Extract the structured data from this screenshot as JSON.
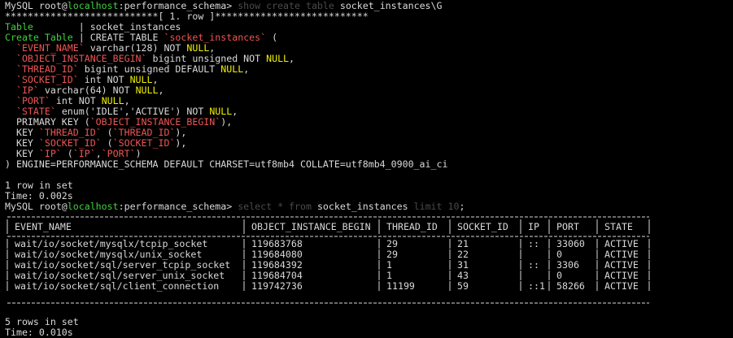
{
  "colors": {
    "background": "#000000",
    "text": "#d9d9d9",
    "green": "#3ed13e",
    "red": "#ee5555",
    "yellow": "#f0f000",
    "dim": "#4a4a4a",
    "cyan": "#00c8d6"
  },
  "prompt1": {
    "prefix": "MySQL root@",
    "host": "localhost",
    "db": ":performance_schema>",
    "kw1": " show create table ",
    "arg": "socket_instances\\G"
  },
  "row_banner": "***************************[ 1. row ]***************************",
  "result_ct": {
    "table_key": "Table",
    "table_pad": "        ",
    "table_sep": "| ",
    "table_val": "socket_instances",
    "ct_key": "Create Table",
    "ct_sep": " | ",
    "ct_val1": "CREATE TABLE ",
    "ct_name": "`socket_instances`",
    "ct_val2": " ("
  },
  "ddl": {
    "l1a": "  ",
    "l1b": "`EVENT_NAME`",
    "l1c": " varchar(128) NOT ",
    "l1d": "NULL",
    "l1e": ",",
    "l2a": "  ",
    "l2b": "`OBJECT_INSTANCE_BEGIN`",
    "l2c": " bigint unsigned NOT ",
    "l2d": "NULL",
    "l2e": ",",
    "l3a": "  ",
    "l3b": "`THREAD_ID`",
    "l3c": " bigint unsigned DEFAULT ",
    "l3d": "NULL",
    "l3e": ",",
    "l4a": "  ",
    "l4b": "`SOCKET_ID`",
    "l4c": " int NOT ",
    "l4d": "NULL",
    "l4e": ",",
    "l5a": "  ",
    "l5b": "`IP`",
    "l5c": " varchar(64) NOT ",
    "l5d": "NULL",
    "l5e": ",",
    "l6a": "  ",
    "l6b": "`PORT`",
    "l6c": " int NOT ",
    "l6d": "NULL",
    "l6e": ",",
    "l7a": "  ",
    "l7b": "`STATE`",
    "l7c": " enum('IDLE','ACTIVE') NOT ",
    "l7d": "NULL",
    "l7e": ",",
    "l8a": "  PRIMARY KEY (",
    "l8b": "`OBJECT_INSTANCE_BEGIN`",
    "l8c": "),",
    "l9a": "  KEY ",
    "l9b": "`THREAD_ID`",
    "l9c": " (",
    "l9d": "`THREAD_ID`",
    "l9e": "),",
    "l10a": "  KEY ",
    "l10b": "`SOCKET_ID`",
    "l10c": " (",
    "l10d": "`SOCKET_ID`",
    "l10e": "),",
    "l11a": "  KEY ",
    "l11b": "`IP`",
    "l11c": " (",
    "l11d": "`IP`",
    "l11e": ",",
    "l11f": "`PORT`",
    "l11g": ")",
    "l12": ") ENGINE=PERFORMANCE_SCHEMA DEFAULT CHARSET=utf8mb4 COLLATE=utf8mb4_0900_ai_ci"
  },
  "status1": {
    "rows": "1 row in set",
    "time": "Time: 0.002s"
  },
  "prompt2": {
    "prefix": "MySQL root@",
    "host": "localhost",
    "db": ":performance_schema>",
    "kw1": " select ",
    "star": "*",
    "kw2": " from ",
    "arg": "socket_instances",
    "kw3": " limit ",
    "num": "10",
    "semi": ";"
  },
  "table": {
    "border": "+---------------------------------+-----------------------+-----------+-----------+-------+--------+----------+",
    "header_line": "| EVENT_NAME                      | OBJECT_INSTANCE_BEGIN | THREAD_ID | SOCKET_ID | IP    | PORT   | STATE    |",
    "header_sep": "|---------------------------------+-----------------------+-----------+-----------+-------+--------+----------|",
    "columns": [
      "EVENT_NAME",
      "OBJECT_INSTANCE_BEGIN",
      "THREAD_ID",
      "SOCKET_ID",
      "IP",
      "PORT",
      "STATE"
    ],
    "rows": [
      "| wait/io/socket/mysqlx/tcpip_socket | 119683768           | 29        | 21        | ::    | 33060  | ACTIVE   |",
      "| wait/io/socket/mysqlx/unix_socket  | 119684080           | 29        | 22        |       | 0      | ACTIVE   |",
      "| wait/io/socket/sql/server_tcpip_socket | 119684392       | 1         | 31        | ::    | 3306   | ACTIVE   |",
      "| wait/io/socket/sql/server_unix_socket  | 119684704       | 1         | 43        |       | 0      | ACTIVE   |",
      "| wait/io/socket/sql/client_connection   | 119742736       | 11199     | 59        | ::1   | 58266  | ACTIVE   |"
    ],
    "cells": [
      [
        "wait/io/socket/mysqlx/tcpip_socket",
        "119683768",
        "29",
        "21",
        "::",
        "33060",
        "ACTIVE"
      ],
      [
        "wait/io/socket/mysqlx/unix_socket",
        "119684080",
        "29",
        "22",
        "",
        "0",
        "ACTIVE"
      ],
      [
        "wait/io/socket/sql/server_tcpip_socket",
        "119684392",
        "1",
        "31",
        "::",
        "3306",
        "ACTIVE"
      ],
      [
        "wait/io/socket/sql/server_unix_socket",
        "119684704",
        "1",
        "43",
        "",
        "0",
        "ACTIVE"
      ],
      [
        "wait/io/socket/sql/client_connection",
        "119742736",
        "11199",
        "59",
        "::1",
        "58266",
        "ACTIVE"
      ]
    ]
  },
  "status2": {
    "rows": "5 rows in set",
    "time": "Time: 0.010s"
  }
}
